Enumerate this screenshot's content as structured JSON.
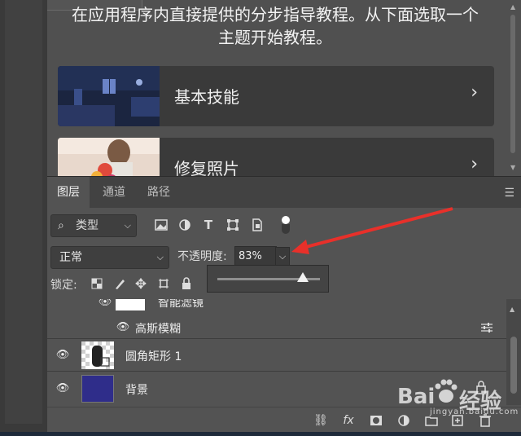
{
  "learn": {
    "intro_line1": "在应用程序内直接提供的分步指导教程。从下面选取一个",
    "intro_line2": "主题开始教程。",
    "cards": [
      {
        "label": "基本技能",
        "chevron": "›"
      },
      {
        "label": "修复照片",
        "chevron": "›"
      }
    ]
  },
  "layers_panel": {
    "tabs": [
      "图层",
      "通道",
      "路径"
    ],
    "active_tab": "图层",
    "menu_icon": "☰",
    "filter": {
      "kind_label": "类型",
      "icons": [
        "image-filter-icon",
        "adjustment-filter-icon",
        "type-filter-icon",
        "shape-filter-icon",
        "smart-object-filter-icon"
      ]
    },
    "blend_mode": "正常",
    "opacity_label": "不透明度:",
    "opacity_value": "83%",
    "opacity_fraction": 0.83,
    "lock_label": "锁定:",
    "layers": [
      {
        "name": "智能滤镜"
      },
      {
        "name": "高斯模糊"
      },
      {
        "name": "圆角矩形 1"
      },
      {
        "name": "背景"
      }
    ],
    "bottom_icons": [
      "link-layers-icon",
      "fx-icon",
      "mask-icon",
      "adjustment-icon",
      "group-icon",
      "new-layer-icon",
      "delete-icon"
    ],
    "fx_text": "fx"
  },
  "watermark": {
    "text_left": "Bai",
    "text_right": "经验",
    "url": "jingyan.baidu.com"
  },
  "colors": {
    "annotation_arrow": "#e8302a",
    "background_layer_fill": "#2f2d8a",
    "panel_bg": "#535353"
  }
}
